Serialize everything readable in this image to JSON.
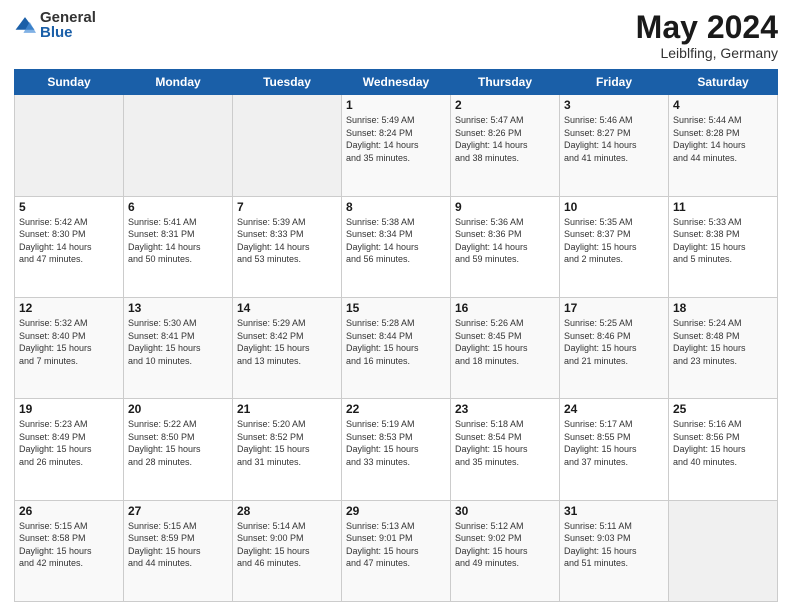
{
  "logo": {
    "general": "General",
    "blue": "Blue"
  },
  "header": {
    "month": "May 2024",
    "location": "Leiblfing, Germany"
  },
  "weekdays": [
    "Sunday",
    "Monday",
    "Tuesday",
    "Wednesday",
    "Thursday",
    "Friday",
    "Saturday"
  ],
  "weeks": [
    [
      {
        "day": "",
        "info": ""
      },
      {
        "day": "",
        "info": ""
      },
      {
        "day": "",
        "info": ""
      },
      {
        "day": "1",
        "info": "Sunrise: 5:49 AM\nSunset: 8:24 PM\nDaylight: 14 hours\nand 35 minutes."
      },
      {
        "day": "2",
        "info": "Sunrise: 5:47 AM\nSunset: 8:26 PM\nDaylight: 14 hours\nand 38 minutes."
      },
      {
        "day": "3",
        "info": "Sunrise: 5:46 AM\nSunset: 8:27 PM\nDaylight: 14 hours\nand 41 minutes."
      },
      {
        "day": "4",
        "info": "Sunrise: 5:44 AM\nSunset: 8:28 PM\nDaylight: 14 hours\nand 44 minutes."
      }
    ],
    [
      {
        "day": "5",
        "info": "Sunrise: 5:42 AM\nSunset: 8:30 PM\nDaylight: 14 hours\nand 47 minutes."
      },
      {
        "day": "6",
        "info": "Sunrise: 5:41 AM\nSunset: 8:31 PM\nDaylight: 14 hours\nand 50 minutes."
      },
      {
        "day": "7",
        "info": "Sunrise: 5:39 AM\nSunset: 8:33 PM\nDaylight: 14 hours\nand 53 minutes."
      },
      {
        "day": "8",
        "info": "Sunrise: 5:38 AM\nSunset: 8:34 PM\nDaylight: 14 hours\nand 56 minutes."
      },
      {
        "day": "9",
        "info": "Sunrise: 5:36 AM\nSunset: 8:36 PM\nDaylight: 14 hours\nand 59 minutes."
      },
      {
        "day": "10",
        "info": "Sunrise: 5:35 AM\nSunset: 8:37 PM\nDaylight: 15 hours\nand 2 minutes."
      },
      {
        "day": "11",
        "info": "Sunrise: 5:33 AM\nSunset: 8:38 PM\nDaylight: 15 hours\nand 5 minutes."
      }
    ],
    [
      {
        "day": "12",
        "info": "Sunrise: 5:32 AM\nSunset: 8:40 PM\nDaylight: 15 hours\nand 7 minutes."
      },
      {
        "day": "13",
        "info": "Sunrise: 5:30 AM\nSunset: 8:41 PM\nDaylight: 15 hours\nand 10 minutes."
      },
      {
        "day": "14",
        "info": "Sunrise: 5:29 AM\nSunset: 8:42 PM\nDaylight: 15 hours\nand 13 minutes."
      },
      {
        "day": "15",
        "info": "Sunrise: 5:28 AM\nSunset: 8:44 PM\nDaylight: 15 hours\nand 16 minutes."
      },
      {
        "day": "16",
        "info": "Sunrise: 5:26 AM\nSunset: 8:45 PM\nDaylight: 15 hours\nand 18 minutes."
      },
      {
        "day": "17",
        "info": "Sunrise: 5:25 AM\nSunset: 8:46 PM\nDaylight: 15 hours\nand 21 minutes."
      },
      {
        "day": "18",
        "info": "Sunrise: 5:24 AM\nSunset: 8:48 PM\nDaylight: 15 hours\nand 23 minutes."
      }
    ],
    [
      {
        "day": "19",
        "info": "Sunrise: 5:23 AM\nSunset: 8:49 PM\nDaylight: 15 hours\nand 26 minutes."
      },
      {
        "day": "20",
        "info": "Sunrise: 5:22 AM\nSunset: 8:50 PM\nDaylight: 15 hours\nand 28 minutes."
      },
      {
        "day": "21",
        "info": "Sunrise: 5:20 AM\nSunset: 8:52 PM\nDaylight: 15 hours\nand 31 minutes."
      },
      {
        "day": "22",
        "info": "Sunrise: 5:19 AM\nSunset: 8:53 PM\nDaylight: 15 hours\nand 33 minutes."
      },
      {
        "day": "23",
        "info": "Sunrise: 5:18 AM\nSunset: 8:54 PM\nDaylight: 15 hours\nand 35 minutes."
      },
      {
        "day": "24",
        "info": "Sunrise: 5:17 AM\nSunset: 8:55 PM\nDaylight: 15 hours\nand 37 minutes."
      },
      {
        "day": "25",
        "info": "Sunrise: 5:16 AM\nSunset: 8:56 PM\nDaylight: 15 hours\nand 40 minutes."
      }
    ],
    [
      {
        "day": "26",
        "info": "Sunrise: 5:15 AM\nSunset: 8:58 PM\nDaylight: 15 hours\nand 42 minutes."
      },
      {
        "day": "27",
        "info": "Sunrise: 5:15 AM\nSunset: 8:59 PM\nDaylight: 15 hours\nand 44 minutes."
      },
      {
        "day": "28",
        "info": "Sunrise: 5:14 AM\nSunset: 9:00 PM\nDaylight: 15 hours\nand 46 minutes."
      },
      {
        "day": "29",
        "info": "Sunrise: 5:13 AM\nSunset: 9:01 PM\nDaylight: 15 hours\nand 47 minutes."
      },
      {
        "day": "30",
        "info": "Sunrise: 5:12 AM\nSunset: 9:02 PM\nDaylight: 15 hours\nand 49 minutes."
      },
      {
        "day": "31",
        "info": "Sunrise: 5:11 AM\nSunset: 9:03 PM\nDaylight: 15 hours\nand 51 minutes."
      },
      {
        "day": "",
        "info": ""
      }
    ]
  ]
}
